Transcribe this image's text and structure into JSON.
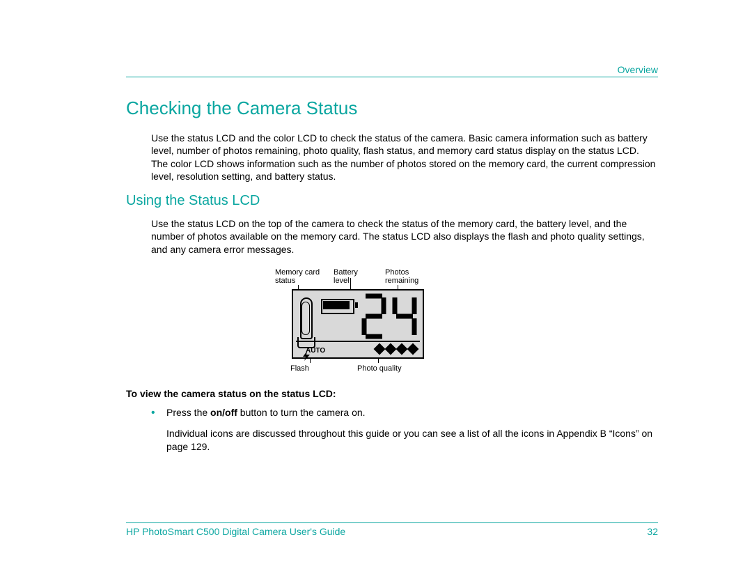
{
  "header": {
    "section_label": "Overview"
  },
  "footer": {
    "doc_title": "HP PhotoSmart C500 Digital Camera User's Guide",
    "page_number": "32"
  },
  "headings": {
    "h1": "Checking the Camera Status",
    "h2": "Using the Status LCD"
  },
  "paragraphs": {
    "p1": "Use the status LCD and the color LCD to check the status of the camera. Basic camera information such as battery level, number of photos remaining, photo quality, flash status, and memory card status display on the status LCD. The color LCD shows information such as the number of photos stored on the memory card, the current compression level, resolution setting, and battery status.",
    "p2": "Use the status LCD on the top of the camera to check the status of the memory card, the battery level, and the number of photos available on the memory card. The status LCD also displays the flash and photo quality settings, and any camera error messages."
  },
  "figure": {
    "captions": {
      "memory_card_status": "Memory card status",
      "battery_level": "Battery level",
      "photos_remaining": "Photos remaining",
      "flash": "Flash",
      "photo_quality": "Photo quality"
    },
    "lcd": {
      "photos_remaining_value": "24",
      "flash_mode": "AUTO",
      "quality_diamonds": 4
    }
  },
  "instructions": {
    "title": "To view the camera status on the status LCD:",
    "bullet_prefix": "Press the ",
    "bullet_bold": "on/off",
    "bullet_suffix": " button to turn the camera on.",
    "followup": "Individual icons are discussed throughout this guide or you can see a list of all the icons in Appendix B “Icons” on page 129."
  }
}
